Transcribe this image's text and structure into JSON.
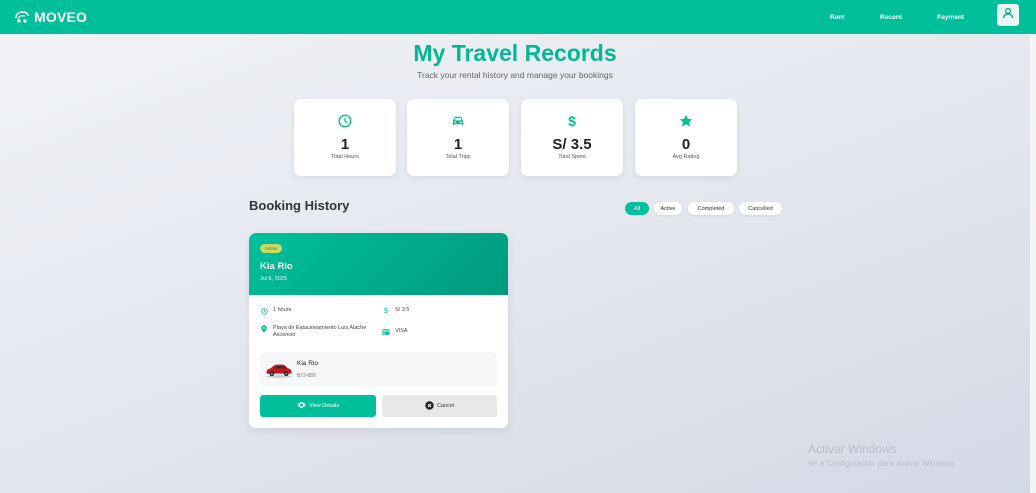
{
  "colors": {
    "accent": "#00bf9a",
    "badge": "#c8dc63"
  },
  "brand": {
    "name": "MOVEO",
    "icon": "car-logo-icon"
  },
  "nav": {
    "rent": "Rent",
    "record": "Record",
    "payment": "Payment",
    "user_icon": "user-icon"
  },
  "header": {
    "title": "My Travel Records",
    "subtitle": "Track your rental history and manage your bookings"
  },
  "stats": [
    {
      "value": "1",
      "label": "Total Hours",
      "icon": "clock-icon"
    },
    {
      "value": "1",
      "label": "Total Trips",
      "icon": "car-icon"
    },
    {
      "value": "S/ 3.5",
      "label": "Total Spent",
      "icon": "dollar-icon"
    },
    {
      "value": "0",
      "label": "Avg Rating",
      "icon": "star-icon"
    }
  ],
  "history": {
    "title": "Booking History",
    "filters": [
      "All",
      "Active",
      "Completed",
      "Cancelled"
    ],
    "selected_filter": "All"
  },
  "booking": {
    "status": "Active",
    "car": "Kia Rio",
    "date": "Jul 6, 2025",
    "duration": "1 hours",
    "price": "S/ 3.5",
    "location": "Playa de Estacionamiento Luis Alache Ascencio",
    "payment_method": "VISA",
    "vehicle_name": "Kia Rio",
    "vehicle_plate": "B7J-889",
    "view_label": "View Details",
    "cancel_label": "Cancel"
  },
  "watermark": {
    "title": "Activar Windows",
    "subtitle": "Ve a Configuración para activar Windows."
  }
}
